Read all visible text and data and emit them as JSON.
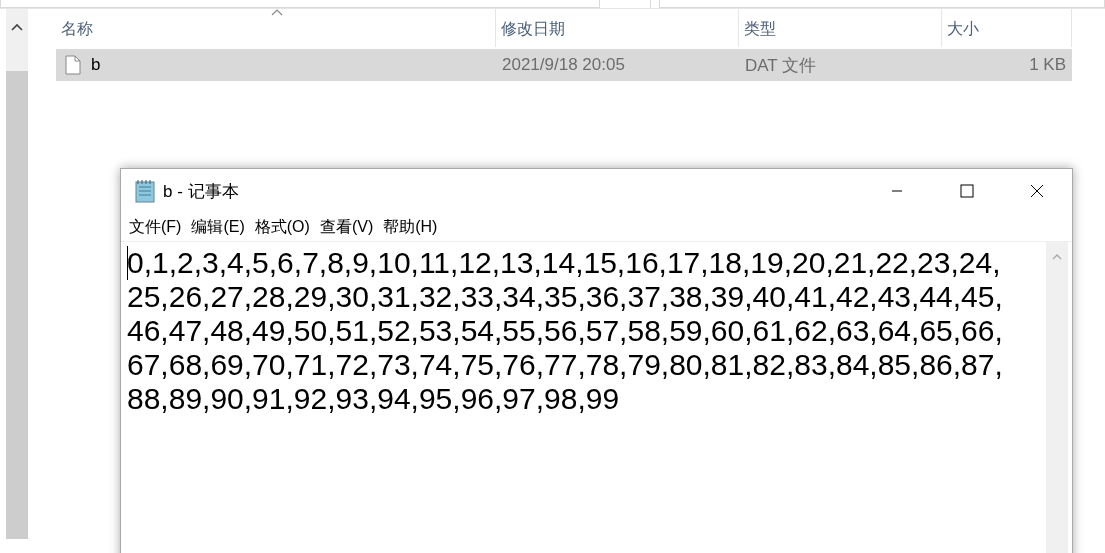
{
  "explorer": {
    "columns": [
      {
        "label": "名称",
        "sorted": true
      },
      {
        "label": "修改日期",
        "sorted": false
      },
      {
        "label": "类型",
        "sorted": false
      },
      {
        "label": "大小",
        "sorted": false
      }
    ],
    "rows": [
      {
        "name": "b",
        "modified": "2021/9/18 20:05",
        "type": "DAT 文件",
        "size": "1 KB",
        "selected": true
      }
    ]
  },
  "notepad": {
    "title": "b - 记事本",
    "menu": [
      "文件(F)",
      "编辑(E)",
      "格式(O)",
      "查看(V)",
      "帮助(H)"
    ],
    "lines": [
      "0,1,2,3,4,5,6,7,8,9,10,11,12,13,14,15,16,17,18,19,20,21,22,23,24,",
      "25,26,27,28,29,30,31,32,33,34,35,36,37,38,39,40,41,42,43,44,45,",
      "46,47,48,49,50,51,52,53,54,55,56,57,58,59,60,61,62,63,64,65,66,",
      "67,68,69,70,71,72,73,74,75,76,77,78,79,80,81,82,83,84,85,86,87,",
      "88,89,90,91,92,93,94,95,96,97,98,99"
    ]
  }
}
